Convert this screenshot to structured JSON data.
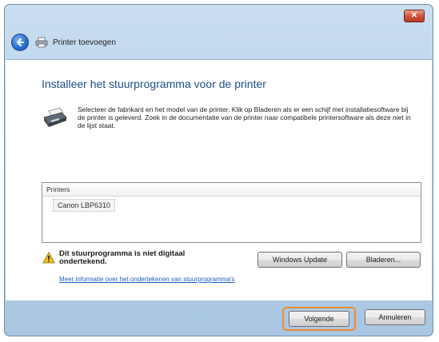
{
  "window": {
    "close_label": "✕",
    "title": "Printer toevoegen"
  },
  "main": {
    "heading": "Installeer het stuurprogramma voor de printer",
    "description": "Selecteer de fabrikant en het model van de printer. Klik op Bladeren als er een schijf met installatiesoftware bij de printer is geleverd. Zoek in de documentatie van de printer naar compatibele printersoftware als deze niet in de lijst staat.",
    "list": {
      "header": "Printers",
      "items": [
        "Canon LBP6310"
      ]
    },
    "warning": "Dit stuurprogramma is niet digitaal ondertekend.",
    "info_link": "Meer informatie over het ondertekenen van stuurprogramma's",
    "windows_update_label": "Windows Update",
    "browse_label": "Bladeren..."
  },
  "footer": {
    "next_label": "Volgende",
    "cancel_label": "Annuleren"
  },
  "colors": {
    "heading": "#1f4e8c",
    "link": "#1a5fc0",
    "highlight": "#f08a2b",
    "close_button": "#c7432b"
  },
  "icons": [
    "close-icon",
    "back-arrow-icon",
    "printer-icon",
    "printer-illustration-icon",
    "warning-shield-icon"
  ]
}
